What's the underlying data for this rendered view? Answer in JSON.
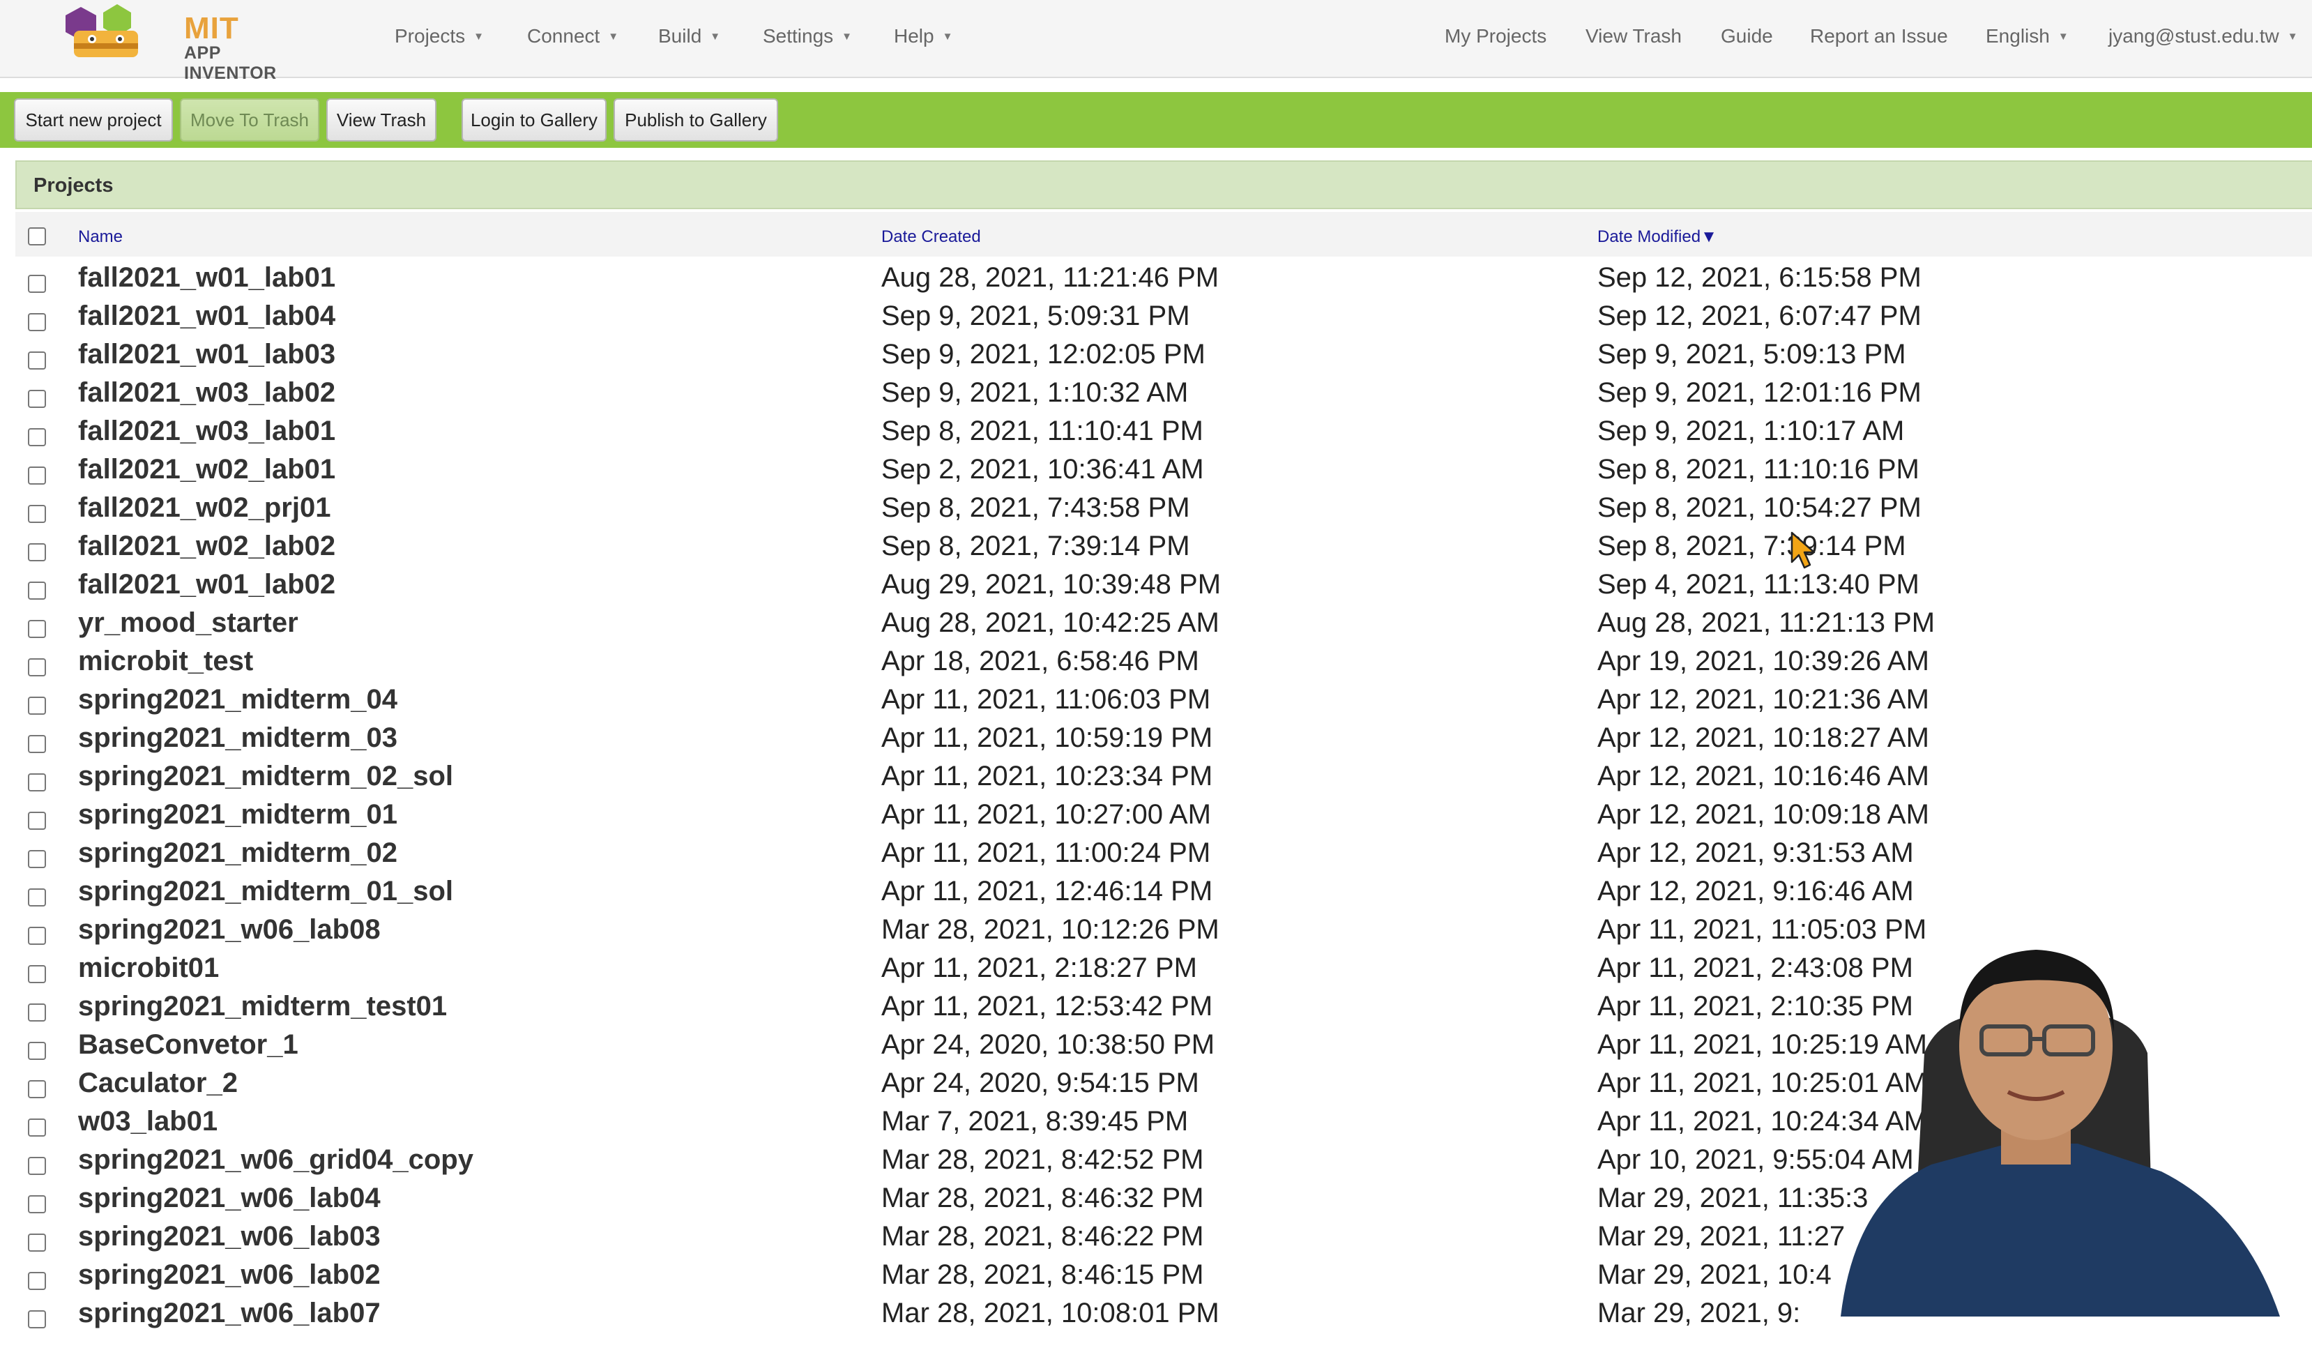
{
  "brand": {
    "line1": "MIT",
    "line2": "APP INVENTOR"
  },
  "nav_left": [
    {
      "label": "Projects"
    },
    {
      "label": "Connect"
    },
    {
      "label": "Build"
    },
    {
      "label": "Settings"
    },
    {
      "label": "Help"
    }
  ],
  "nav_right": {
    "my_projects": "My Projects",
    "view_trash": "View Trash",
    "guide": "Guide",
    "report": "Report an Issue",
    "language": "English",
    "user": "jyang@stust.edu.tw"
  },
  "toolbar": {
    "start_new": "Start new project",
    "move_to_trash": "Move To Trash",
    "view_trash": "View Trash",
    "login_gallery": "Login to Gallery",
    "publish_gallery": "Publish to Gallery"
  },
  "panel": {
    "title": "Projects"
  },
  "columns": {
    "name": "Name",
    "created": "Date Created",
    "modified": "Date Modified",
    "sort_indicator": "▼"
  },
  "projects": [
    {
      "name": "fall2021_w01_lab01",
      "created": "Aug 28, 2021, 11:21:46 PM",
      "modified": "Sep 12, 2021, 6:15:58 PM"
    },
    {
      "name": "fall2021_w01_lab04",
      "created": "Sep 9, 2021, 5:09:31 PM",
      "modified": "Sep 12, 2021, 6:07:47 PM"
    },
    {
      "name": "fall2021_w01_lab03",
      "created": "Sep 9, 2021, 12:02:05 PM",
      "modified": "Sep 9, 2021, 5:09:13 PM"
    },
    {
      "name": "fall2021_w03_lab02",
      "created": "Sep 9, 2021, 1:10:32 AM",
      "modified": "Sep 9, 2021, 12:01:16 PM"
    },
    {
      "name": "fall2021_w03_lab01",
      "created": "Sep 8, 2021, 11:10:41 PM",
      "modified": "Sep 9, 2021, 1:10:17 AM"
    },
    {
      "name": "fall2021_w02_lab01",
      "created": "Sep 2, 2021, 10:36:41 AM",
      "modified": "Sep 8, 2021, 11:10:16 PM"
    },
    {
      "name": "fall2021_w02_prj01",
      "created": "Sep 8, 2021, 7:43:58 PM",
      "modified": "Sep 8, 2021, 10:54:27 PM"
    },
    {
      "name": "fall2021_w02_lab02",
      "created": "Sep 8, 2021, 7:39:14 PM",
      "modified": "Sep 8, 2021, 7:39:14 PM"
    },
    {
      "name": "fall2021_w01_lab02",
      "created": "Aug 29, 2021, 10:39:48 PM",
      "modified": "Sep 4, 2021, 11:13:40 PM"
    },
    {
      "name": "yr_mood_starter",
      "created": "Aug 28, 2021, 10:42:25 AM",
      "modified": "Aug 28, 2021, 11:21:13 PM"
    },
    {
      "name": "microbit_test",
      "created": "Apr 18, 2021, 6:58:46 PM",
      "modified": "Apr 19, 2021, 10:39:26 AM"
    },
    {
      "name": "spring2021_midterm_04",
      "created": "Apr 11, 2021, 11:06:03 PM",
      "modified": "Apr 12, 2021, 10:21:36 AM"
    },
    {
      "name": "spring2021_midterm_03",
      "created": "Apr 11, 2021, 10:59:19 PM",
      "modified": "Apr 12, 2021, 10:18:27 AM"
    },
    {
      "name": "spring2021_midterm_02_sol",
      "created": "Apr 11, 2021, 10:23:34 PM",
      "modified": "Apr 12, 2021, 10:16:46 AM"
    },
    {
      "name": "spring2021_midterm_01",
      "created": "Apr 11, 2021, 10:27:00 AM",
      "modified": "Apr 12, 2021, 10:09:18 AM"
    },
    {
      "name": "spring2021_midterm_02",
      "created": "Apr 11, 2021, 11:00:24 PM",
      "modified": "Apr 12, 2021, 9:31:53 AM"
    },
    {
      "name": "spring2021_midterm_01_sol",
      "created": "Apr 11, 2021, 12:46:14 PM",
      "modified": "Apr 12, 2021, 9:16:46 AM"
    },
    {
      "name": "spring2021_w06_lab08",
      "created": "Mar 28, 2021, 10:12:26 PM",
      "modified": "Apr 11, 2021, 11:05:03 PM"
    },
    {
      "name": "microbit01",
      "created": "Apr 11, 2021, 2:18:27 PM",
      "modified": "Apr 11, 2021, 2:43:08 PM"
    },
    {
      "name": "spring2021_midterm_test01",
      "created": "Apr 11, 2021, 12:53:42 PM",
      "modified": "Apr 11, 2021, 2:10:35 PM"
    },
    {
      "name": "BaseConvetor_1",
      "created": "Apr 24, 2020, 10:38:50 PM",
      "modified": "Apr 11, 2021, 10:25:19 AM"
    },
    {
      "name": "Caculator_2",
      "created": "Apr 24, 2020, 9:54:15 PM",
      "modified": "Apr 11, 2021, 10:25:01 AM"
    },
    {
      "name": "w03_lab01",
      "created": "Mar 7, 2021, 8:39:45 PM",
      "modified": "Apr 11, 2021, 10:24:34 AM"
    },
    {
      "name": "spring2021_w06_grid04_copy",
      "created": "Mar 28, 2021, 8:42:52 PM",
      "modified": "Apr 10, 2021, 9:55:04 AM"
    },
    {
      "name": "spring2021_w06_lab04",
      "created": "Mar 28, 2021, 8:46:32 PM",
      "modified": "Mar 29, 2021, 11:35:3"
    },
    {
      "name": "spring2021_w06_lab03",
      "created": "Mar 28, 2021, 8:46:22 PM",
      "modified": "Mar 29, 2021, 11:27"
    },
    {
      "name": "spring2021_w06_lab02",
      "created": "Mar 28, 2021, 8:46:15 PM",
      "modified": "Mar 29, 2021, 10:4"
    },
    {
      "name": "spring2021_w06_lab07",
      "created": "Mar 28, 2021, 10:08:01 PM",
      "modified": "Mar 29, 2021, 9:"
    }
  ]
}
